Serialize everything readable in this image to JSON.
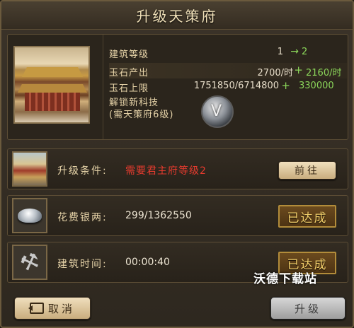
{
  "dialog": {
    "title": "升级天策府"
  },
  "stats": {
    "level": {
      "label": "建筑等级",
      "current": "1",
      "next": "2"
    },
    "jade_output": {
      "label": "玉石产出",
      "current": "2700/时",
      "next": "2160/时"
    },
    "jade_cap": {
      "label": "玉石上限",
      "current": "1751850/6714800",
      "next": "330000"
    },
    "unlock": {
      "label_line1": "解锁新科技",
      "label_line2": "(需天策府6级)"
    }
  },
  "requirements": [
    {
      "label": "升级条件:",
      "value": "需要君主府等级2",
      "action": "前往",
      "icon": "palace-icon"
    },
    {
      "label": "花费银两:",
      "value": "299/1362550",
      "status": "已达成",
      "icon": "silver-ingot-icon"
    },
    {
      "label": "建筑时间:",
      "value": "00:00:40",
      "status": "已达成",
      "icon": "hammer-icon"
    }
  ],
  "watermark": "沃德下载站",
  "buttons": {
    "cancel": "取消",
    "upgrade": "升级"
  },
  "colors": {
    "green": "#8bd65a",
    "red": "#e53b2e",
    "gold": "#f3cf6a"
  },
  "symbols": {
    "arrow": "→",
    "plus": "+",
    "tech_glyph": "V",
    "hammer_glyph": "⚒"
  }
}
